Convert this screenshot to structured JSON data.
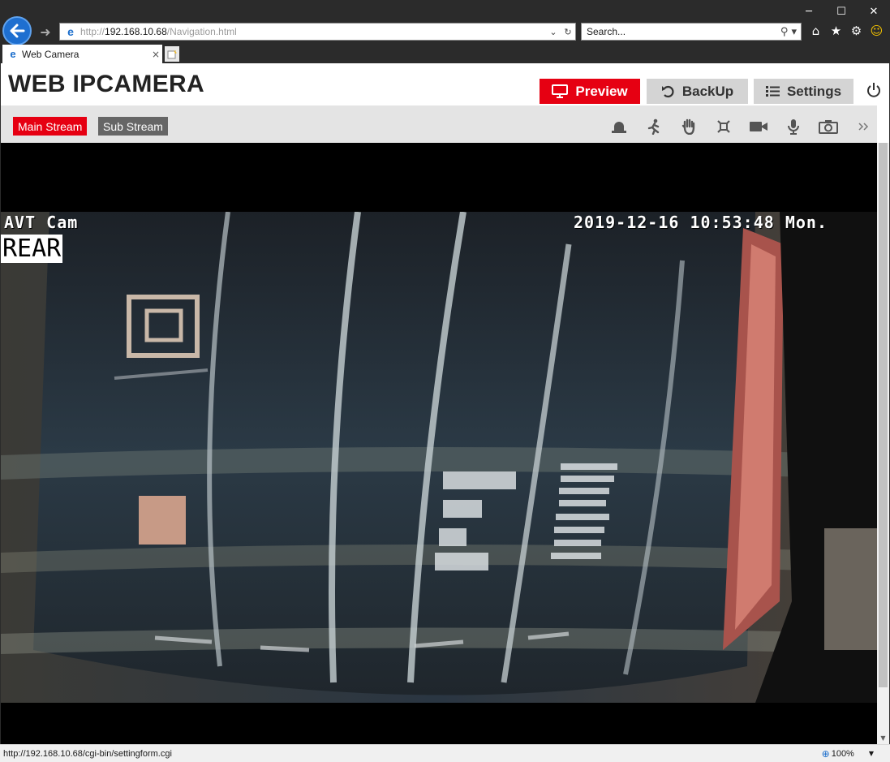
{
  "browser": {
    "url_prefix": "http://",
    "url_host": "192.168.10.68",
    "url_path": "/Navigation.html",
    "search_placeholder": "Search...",
    "tab_title": "Web Camera",
    "status_url": "http://192.168.10.68/cgi-bin/settingform.cgi",
    "zoom": "100%"
  },
  "app": {
    "title": "WEB IPCAMERA",
    "nav": {
      "preview": "Preview",
      "backup": "BackUp",
      "settings": "Settings"
    },
    "streams": {
      "main": "Main Stream",
      "sub": "Sub Stream"
    },
    "toolbar_icons": [
      "alarm-icon",
      "motion-detect-icon",
      "hand-icon",
      "tamper-icon",
      "record-icon",
      "microphone-icon",
      "snapshot-icon",
      "more-icon"
    ]
  },
  "video": {
    "camera_name": "AVT Cam",
    "timestamp": "2019-12-16 10:53:48 Mon.",
    "camera_label": "REAR"
  },
  "colors": {
    "accent": "#e60012",
    "inactive_nav": "#d4d4d4",
    "chrome_bg": "#2b2b2b"
  }
}
